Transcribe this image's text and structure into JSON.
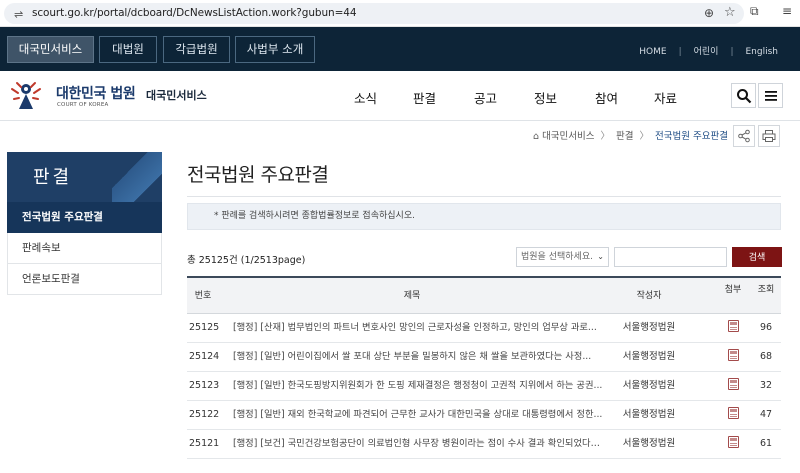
{
  "browser": {
    "url": "scourt.go.kr/portal/dcboard/DcNewsListAction.work?gubun=44"
  },
  "topbar": {
    "tabs": [
      {
        "label": "대국민서비스",
        "active": true
      },
      {
        "label": "대법원",
        "active": false
      },
      {
        "label": "각급법원",
        "active": false
      },
      {
        "label": "사법부 소개",
        "active": false
      }
    ],
    "links": [
      "HOME",
      "어린이",
      "English"
    ]
  },
  "header": {
    "logo_title": "대한민국 법원",
    "logo_sub": "COURT OF KOREA",
    "service_label": "대국민서비스",
    "nav": [
      "소식",
      "판결",
      "공고",
      "정보",
      "참여",
      "자료"
    ],
    "search_icon": "search-icon",
    "menu_icon": "hamburger-menu-icon"
  },
  "breadcrumb": {
    "items": [
      "대국민서비스",
      "판결",
      "전국법원 주요판결"
    ],
    "home_icon": "home-icon",
    "share_icon": "share-icon",
    "print_icon": "print-icon"
  },
  "sidebar": {
    "heading": "판결",
    "items": [
      {
        "label": "전국법원 주요판결",
        "active": true
      },
      {
        "label": "판례속보",
        "active": false
      },
      {
        "label": "언론보도판결",
        "active": false
      }
    ]
  },
  "main": {
    "title": "전국법원 주요판결",
    "notice": "* 판례를 검색하시려면 종합법률정보로 접속하십시오.",
    "total_label": "총 25125건 (1/2513page)",
    "select_placeholder": "법원을 선택하세요.",
    "search_button": "검색",
    "columns": [
      "번호",
      "제목",
      "작성자",
      "첨부",
      "조회"
    ],
    "rows": [
      {
        "no": "25125",
        "title": "[행정] [산재] 법무법인의 파트너 변호사인 망인의 근로자성을 인정하고, 망인의 업무상 과로...",
        "author": "서울행정법원",
        "views": "96"
      },
      {
        "no": "25124",
        "title": "[행정] [일반] 어린이집에서 쌀 포대 상단 부분을 밀봉하지 않은 채 쌀을 보관하였다는 사정...",
        "author": "서울행정법원",
        "views": "68"
      },
      {
        "no": "25123",
        "title": "[행정] [일반] 한국도핑방지위원회가 한 도핑 제재결정은 행정청이 고권적 지위에서 하는 공권...",
        "author": "서울행정법원",
        "views": "32"
      },
      {
        "no": "25122",
        "title": "[행정] [일반] 재외 한국학교에 파견되어 근무한 교사가 대한민국을 상대로 대통령령에서 정한...",
        "author": "서울행정법원",
        "views": "47"
      },
      {
        "no": "25121",
        "title": "[행정] [보건] 국민건강보험공단이 의료법인형 사무장 병원이라는 점이 수사 결과 확인되었다는...",
        "author": "서울행정법원",
        "views": "61"
      }
    ]
  },
  "colors": {
    "topbar_bg": "#0d2437",
    "sidebar_head": "#1f3f66",
    "sidebar_active": "#16355a",
    "search_button": "#7d1414"
  }
}
